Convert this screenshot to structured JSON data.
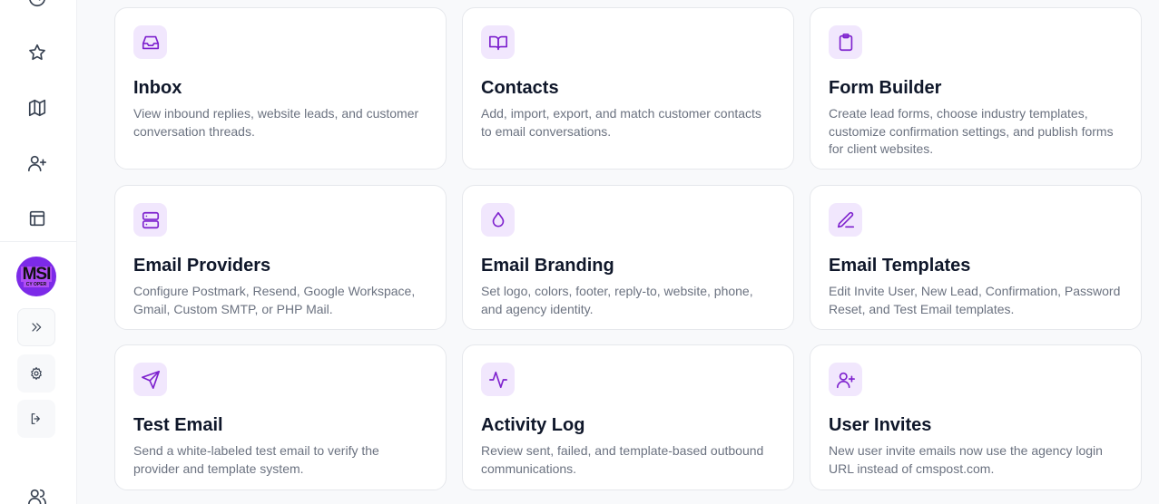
{
  "sidebar": {
    "icons": [
      "clock-icon",
      "star-icon",
      "map-icon",
      "user-plus-icon",
      "layout-icon",
      "users-icon"
    ],
    "avatar": {
      "main": "MSI",
      "sub": "CY OPER"
    },
    "expand_icon": "chevrons-right-icon",
    "settings_icon": "gear-icon",
    "logout_icon": "logout-icon"
  },
  "cards": [
    {
      "icon": "inbox-icon",
      "title": "Inbox",
      "description": "View inbound replies, website leads, and customer conversation threads."
    },
    {
      "icon": "book-open-icon",
      "title": "Contacts",
      "description": "Add, import, export, and match customer contacts to email conversations."
    },
    {
      "icon": "clipboard-icon",
      "title": "Form Builder",
      "description": "Create lead forms, choose industry templates, customize confirmation settings, and publish forms for client websites."
    },
    {
      "icon": "server-icon",
      "title": "Email Providers",
      "description": "Configure Postmark, Resend, Google Workspace, Gmail, Custom SMTP, or PHP Mail."
    },
    {
      "icon": "droplet-icon",
      "title": "Email Branding",
      "description": "Set logo, colors, footer, reply-to, website, phone, and agency identity."
    },
    {
      "icon": "pen-line-icon",
      "title": "Email Templates",
      "description": "Edit Invite User, New Lead, Confirmation, Password Reset, and Test Email templates."
    },
    {
      "icon": "send-icon",
      "title": "Test Email",
      "description": "Send a white-labeled test email to verify the provider and template system."
    },
    {
      "icon": "activity-icon",
      "title": "Activity Log",
      "description": "Review sent, failed, and template-based outbound communications."
    },
    {
      "icon": "user-plus-icon",
      "title": "User Invites",
      "description": "New user invite emails now use the agency login URL instead of cmspost.com."
    }
  ],
  "colors": {
    "accent": "#7e22ce",
    "icon_bg": "#f1e7fd",
    "avatar": "#7c2ae8"
  }
}
